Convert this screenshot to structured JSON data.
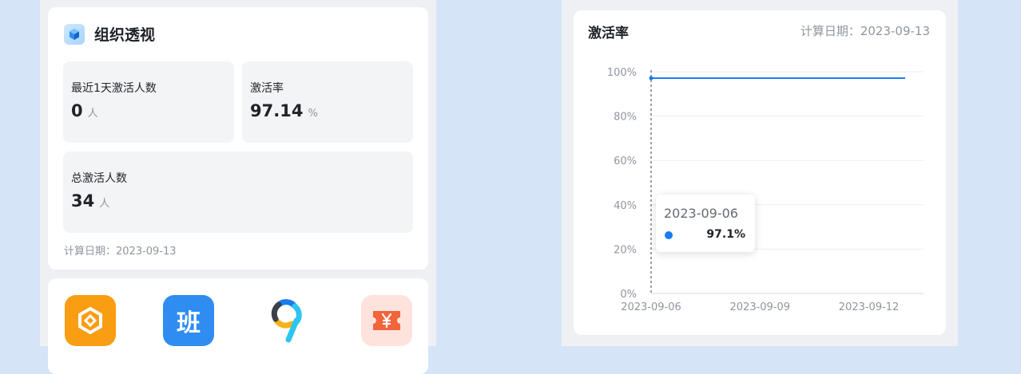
{
  "org": {
    "title": "组织透视",
    "stats": [
      {
        "label": "最近1天激活人数",
        "value": "0",
        "unit": "人"
      },
      {
        "label": "激活率",
        "value": "97.14",
        "unit": "%"
      },
      {
        "label": "总激活人数",
        "value": "34",
        "unit": "人"
      }
    ],
    "calc_date": "计算日期：2023-09-13"
  },
  "apps": [
    {
      "icon": "hexagon-app-icon",
      "color": "#f99d12"
    },
    {
      "icon": "ban-app-icon",
      "label": "班",
      "color": "#2f8cf0"
    },
    {
      "icon": "nine-app-icon",
      "color": "#ffffff"
    },
    {
      "icon": "ticket-yen-app-icon",
      "color": "#fde3dc"
    }
  ],
  "chart_panel": {
    "title": "激活率",
    "calc_date": "计算日期：2023-09-13",
    "tooltip": {
      "date": "2023-09-06",
      "value": "97.1%"
    }
  },
  "chart_data": {
    "type": "line",
    "x": [
      "2023-09-06",
      "2023-09-07",
      "2023-09-08",
      "2023-09-09",
      "2023-09-10",
      "2023-09-11",
      "2023-09-12",
      "2023-09-13"
    ],
    "x_tick_labels": [
      "2023-09-06",
      "2023-09-09",
      "2023-09-12"
    ],
    "series": [
      {
        "values": [
          97.1,
          97.1,
          97.1,
          97.1,
          97.1,
          97.1,
          97.1,
          97.1
        ],
        "color": "#1a7cf0"
      }
    ],
    "y_tick_labels": [
      "0%",
      "20%",
      "40%",
      "60%",
      "80%",
      "100%"
    ],
    "ylim": [
      0,
      100
    ],
    "grid": true,
    "highlight_x": "2023-09-06"
  }
}
